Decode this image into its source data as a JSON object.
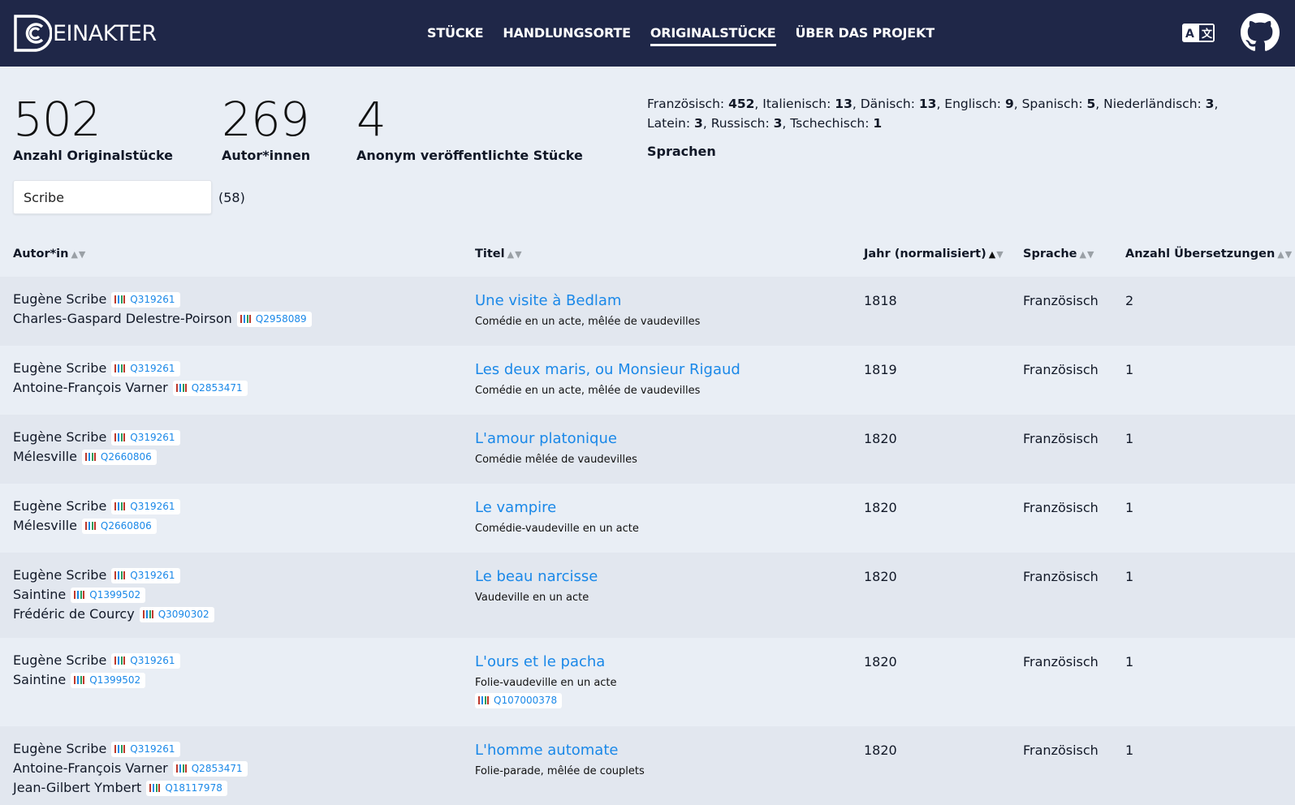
{
  "header": {
    "logo_text": "EINAKTER",
    "nav": [
      "STÜCKE",
      "HANDLUNGSORTE",
      "ORIGINALSTÜCKE",
      "ÜBER DAS PROJEKT"
    ],
    "active_nav": "ORIGINALSTÜCKE"
  },
  "stats": {
    "originals": {
      "value": "502",
      "label": "Anzahl Originalstücke"
    },
    "authors": {
      "value": "269",
      "label": "Autor*innen"
    },
    "anonymous": {
      "value": "4",
      "label": "Anonym veröffentlichte Stücke"
    },
    "languages": [
      {
        "name": "Französisch",
        "count": "452"
      },
      {
        "name": "Italienisch",
        "count": "13"
      },
      {
        "name": "Dänisch",
        "count": "13"
      },
      {
        "name": "Englisch",
        "count": "9"
      },
      {
        "name": "Spanisch",
        "count": "5"
      },
      {
        "name": "Niederländisch",
        "count": "3"
      },
      {
        "name": "Latein",
        "count": "3"
      },
      {
        "name": "Russisch",
        "count": "3"
      },
      {
        "name": "Tschechisch",
        "count": "1"
      }
    ],
    "languages_label": "Sprachen"
  },
  "search": {
    "value": "Scribe",
    "count": "(58)"
  },
  "table": {
    "headers": {
      "author": "Autor*in",
      "title": "Titel",
      "year": "Jahr (normalisiert)",
      "language": "Sprache",
      "translations": "Anzahl Übersetzungen"
    },
    "rows": [
      {
        "authors": [
          {
            "name": "Eugène Scribe",
            "wd": "Q319261"
          },
          {
            "name": "Charles-Gaspard Delestre-Poirson",
            "wd": "Q2958089"
          }
        ],
        "title": "Une visite à Bedlam",
        "subtitle": "Comédie en un acte, mêlée de vaudevilles",
        "title_wd": "",
        "year": "1818",
        "language": "Französisch",
        "translations": "2"
      },
      {
        "authors": [
          {
            "name": "Eugène Scribe",
            "wd": "Q319261"
          },
          {
            "name": "Antoine-François Varner",
            "wd": "Q2853471"
          }
        ],
        "title": "Les deux maris, ou Monsieur Rigaud",
        "subtitle": "Comédie en un acte, mêlée de vaudevilles",
        "title_wd": "",
        "year": "1819",
        "language": "Französisch",
        "translations": "1"
      },
      {
        "authors": [
          {
            "name": "Eugène Scribe",
            "wd": "Q319261"
          },
          {
            "name": "Mélesville",
            "wd": "Q2660806"
          }
        ],
        "title": "L'amour platonique",
        "subtitle": "Comédie mêlée de vaudevilles",
        "title_wd": "",
        "year": "1820",
        "language": "Französisch",
        "translations": "1"
      },
      {
        "authors": [
          {
            "name": "Eugène Scribe",
            "wd": "Q319261"
          },
          {
            "name": "Mélesville",
            "wd": "Q2660806"
          }
        ],
        "title": "Le vampire",
        "subtitle": "Comédie-vaudeville en un acte",
        "title_wd": "",
        "year": "1820",
        "language": "Französisch",
        "translations": "1"
      },
      {
        "authors": [
          {
            "name": "Eugène Scribe",
            "wd": "Q319261"
          },
          {
            "name": "Saintine",
            "wd": "Q1399502"
          },
          {
            "name": "Frédéric de Courcy",
            "wd": "Q3090302"
          }
        ],
        "title": "Le beau narcisse",
        "subtitle": "Vaudeville en un acte",
        "title_wd": "",
        "year": "1820",
        "language": "Französisch",
        "translations": "1"
      },
      {
        "authors": [
          {
            "name": "Eugène Scribe",
            "wd": "Q319261"
          },
          {
            "name": "Saintine",
            "wd": "Q1399502"
          }
        ],
        "title": "L'ours et le pacha",
        "subtitle": "Folie-vaudeville en un acte",
        "title_wd": "Q107000378",
        "year": "1820",
        "language": "Französisch",
        "translations": "1"
      },
      {
        "authors": [
          {
            "name": "Eugène Scribe",
            "wd": "Q319261"
          },
          {
            "name": "Antoine-François Varner",
            "wd": "Q2853471"
          },
          {
            "name": "Jean-Gilbert Ymbert",
            "wd": "Q18117978"
          }
        ],
        "title": "L'homme automate",
        "subtitle": "Folie-parade, mêlée de couplets",
        "title_wd": "",
        "year": "1820",
        "language": "Französisch",
        "translations": "1"
      }
    ]
  },
  "colors": {
    "header_bg": "#1f2748",
    "link": "#1a88e8",
    "page_bg": "#e9eef5",
    "row_alt": "#e2e7ef"
  }
}
